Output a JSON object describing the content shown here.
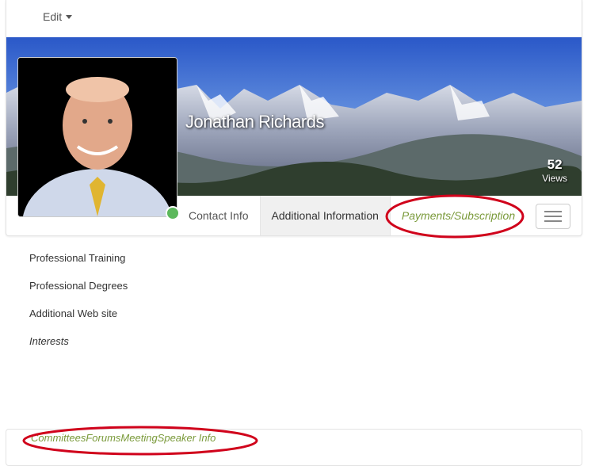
{
  "menu": {
    "edit_label": "Edit"
  },
  "profile": {
    "name": "Jonathan Richards",
    "views_count": "52",
    "views_label": "Views",
    "online_status": "online"
  },
  "tabs": [
    {
      "label": "Contact Info"
    },
    {
      "label": "Additional Information"
    },
    {
      "label": "Payments/Subscription"
    }
  ],
  "info_items": [
    {
      "label": "Professional Training"
    },
    {
      "label": "Professional Degrees"
    },
    {
      "label": "Additional Web site"
    },
    {
      "label": "Interests"
    }
  ],
  "bottom_links": [
    {
      "label": "Committees"
    },
    {
      "label": "Forums"
    },
    {
      "label": "Meeting"
    },
    {
      "label": "Speaker Info"
    }
  ],
  "colors": {
    "link_green": "#7a9a3a",
    "status_green": "#5cb85c",
    "annotation_red": "#d0021b"
  }
}
